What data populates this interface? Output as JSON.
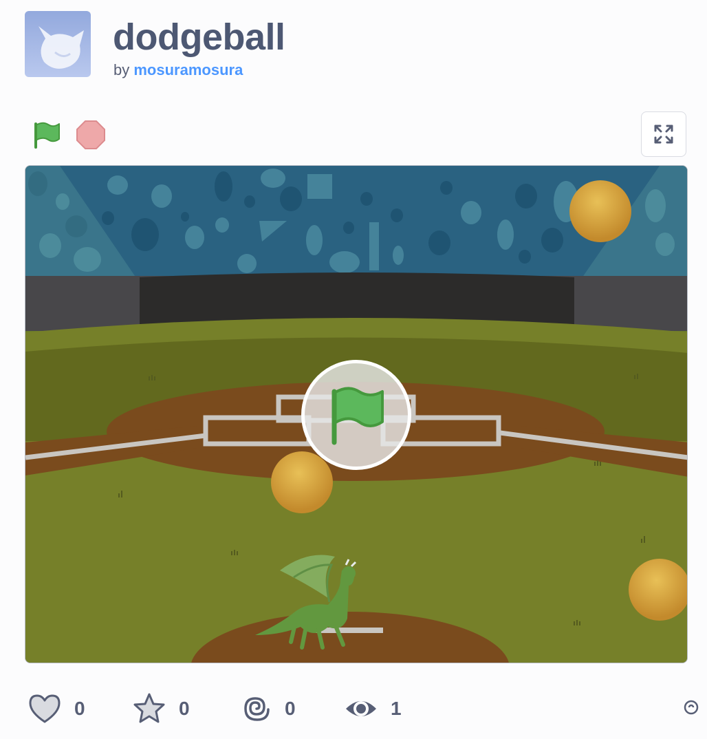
{
  "project": {
    "title": "dodgeball",
    "by_label": "by",
    "author": "mosuramosura"
  },
  "controls": {
    "green_flag_icon": "green-flag-icon",
    "stop_icon": "stop-icon",
    "fullscreen_icon": "fullscreen-icon"
  },
  "stage": {
    "backdrop": "baseball-field",
    "sprites": [
      "ball",
      "ball",
      "ball",
      "dragon"
    ]
  },
  "stats": {
    "loves": "0",
    "favorites": "0",
    "remixes": "0",
    "views": "1"
  },
  "colors": {
    "title": "#4d5873",
    "author_link": "#4c97ff",
    "green_flag": "#5cb85c",
    "stop": "#eea8a9"
  }
}
